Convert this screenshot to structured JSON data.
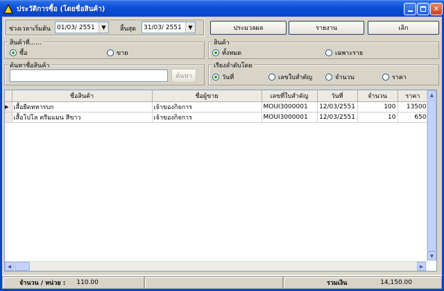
{
  "window": {
    "title": "ประวัติการซื้อ (โดยชื่อสินค้า)",
    "controls": [
      "min-icon",
      "max-icon",
      "close-icon"
    ]
  },
  "filter": {
    "start_label": "ช่วงเวลาเริ่มต้น",
    "start_date": "01/03/ 2551",
    "end_label": "สิ้นสุด",
    "end_date": "31/03/ 2551"
  },
  "toolbar": {
    "process_label": "ประมวลผล",
    "report_label": "รายงาน",
    "cancel_label": "เลิก"
  },
  "item_type_group": {
    "legend": "สินค้าที่......",
    "options": [
      "ซื้อ",
      "ขาย"
    ],
    "selected": "ซื้อ"
  },
  "item_group": {
    "legend": "สินค้า",
    "options": [
      "ทั้งหมด",
      "เฉพาะราย"
    ],
    "selected": "ทั้งหมด"
  },
  "search_group": {
    "legend": "ค้นหาชื่อสินค้า",
    "value": "",
    "button_label": "ค้นหา"
  },
  "sort_group": {
    "legend": "เรียงลำดับโดย",
    "options": [
      "วันที่",
      "เลขใบสำคัญ",
      "จำนวน",
      "ราคา"
    ],
    "selected": "วันที่"
  },
  "table": {
    "columns": [
      "ชื่อสินค้า",
      "ชื่อผู้ขาย",
      "เลขที่ใบสำคัญ",
      "วันที่",
      "จำนวน",
      "ราคา"
    ],
    "rows": [
      [
        "เสื้อยืดทหารบก",
        "เจ้าของกิจการ",
        "MOUI3000001",
        "12/03/2551",
        "100",
        "13500"
      ],
      [
        "เสื้อโปโล ครีมแมน สีขาว",
        "เจ้าของกิจการ",
        "MOUI3000001",
        "12/03/2551",
        "10",
        "650"
      ]
    ]
  },
  "status": {
    "qty_label": "จำนวน / หน่วย :",
    "qty_value": "110.00",
    "total_label": "รวมเงิน",
    "total_value": "14,150.00"
  },
  "colors": {
    "titlebar": "#0a4fd6",
    "window_bg": "#d8d4c8",
    "radio_selected": "#21a121"
  }
}
